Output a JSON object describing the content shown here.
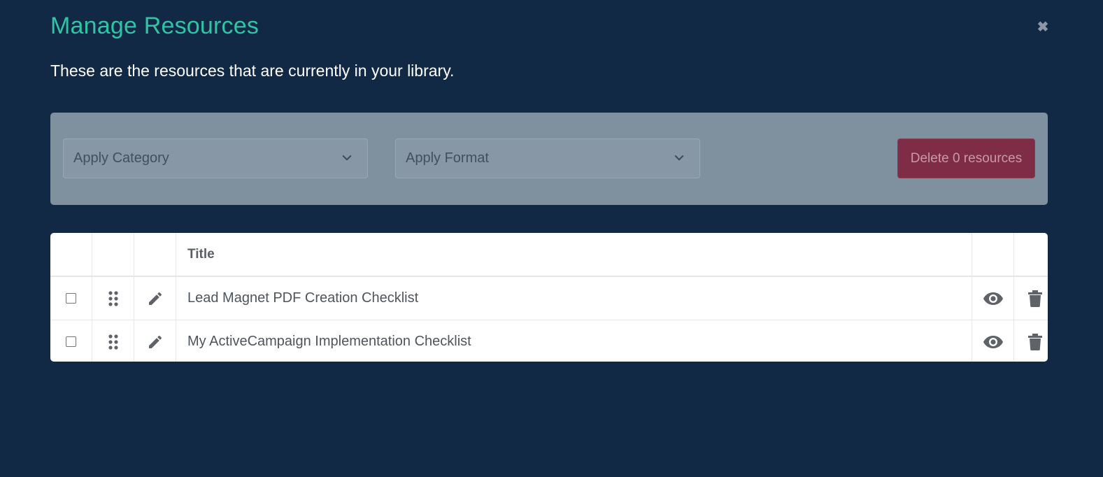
{
  "modal": {
    "title": "Manage Resources",
    "close_glyph": "✖",
    "subtitle": "These are the resources that are currently in your library."
  },
  "toolbar": {
    "category_select": {
      "value": "Apply Category",
      "icon": "chevron-down-icon"
    },
    "format_select": {
      "value": "Apply Format",
      "icon": "chevron-down-icon"
    },
    "delete_button": {
      "label": "Delete 0 resources",
      "color": "#7f2c46"
    }
  },
  "table": {
    "columns": [
      "",
      "",
      "",
      "Title",
      "",
      ""
    ],
    "header_title": "Title",
    "rows": [
      {
        "checked": false,
        "title": "Lead Magnet PDF Creation Checklist"
      },
      {
        "checked": false,
        "title": "My ActiveCampaign Implementation Checklist"
      }
    ],
    "row_icons": [
      "drag-handle-icon",
      "pencil-icon",
      "eye-icon",
      "trash-icon"
    ]
  },
  "colors": {
    "background": "#112944",
    "accent": "#2ec4a6",
    "toolbar": "#7f909f",
    "icon": "#5f6368"
  }
}
